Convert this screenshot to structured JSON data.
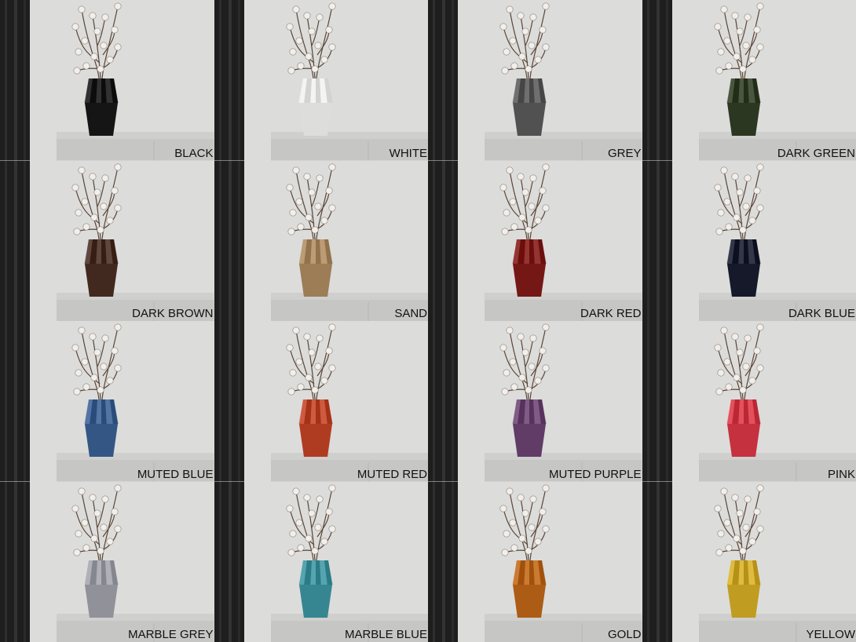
{
  "swatches": [
    {
      "name": "BLACK",
      "color": "#1c1c1c"
    },
    {
      "name": "WHITE",
      "color": "#e6e6e4"
    },
    {
      "name": "GREY",
      "color": "#5a5a5a"
    },
    {
      "name": "DARK GREEN",
      "color": "#35402a"
    },
    {
      "name": "DARK BROWN",
      "color": "#4a3228"
    },
    {
      "name": "SAND",
      "color": "#a5865f"
    },
    {
      "name": "DARK RED",
      "color": "#7e1f1c"
    },
    {
      "name": "DARK BLUE",
      "color": "#1d2233"
    },
    {
      "name": "MUTED BLUE",
      "color": "#3c5f8e"
    },
    {
      "name": "MUTED RED",
      "color": "#b8452a"
    },
    {
      "name": "MUTED PURPLE",
      "color": "#6a4570"
    },
    {
      "name": "PINK",
      "color": "#cf3a48"
    },
    {
      "name": "MARBLE GREY",
      "color": "#9a9aa2"
    },
    {
      "name": "MARBLE BLUE",
      "color": "#3f8f9a"
    },
    {
      "name": "GOLD",
      "color": "#b5651b"
    },
    {
      "name": "YELLOW",
      "color": "#c9a52a"
    }
  ]
}
